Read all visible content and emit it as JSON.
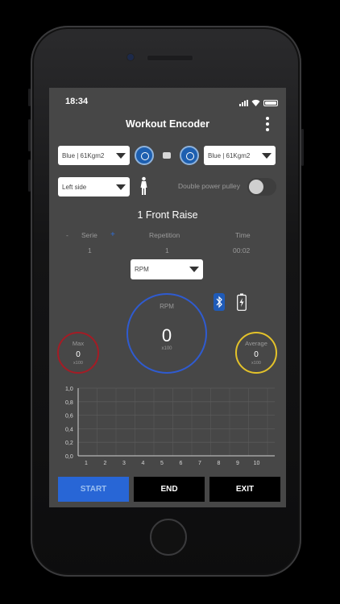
{
  "status": {
    "time": "18:34"
  },
  "header": {
    "title": "Workout Encoder"
  },
  "encoders": {
    "left_select": "Blue | 61Kgm2",
    "right_select": "Blue | 61Kgm2"
  },
  "side": {
    "select": "Left side",
    "double_pulley_label": "Double power pulley",
    "double_pulley_on": false
  },
  "exercise": {
    "title": "1 Front Raise"
  },
  "stats": {
    "serie_label": "Serie",
    "serie_value": "1",
    "serie_minus": "-",
    "serie_plus": "+",
    "repetition_label": "Repetition",
    "repetition_value": "1",
    "time_label": "Time",
    "time_value": "00:02"
  },
  "metric_select": "RPM",
  "gauges": {
    "main": {
      "label": "RPM",
      "value": "0",
      "unit": "x100",
      "color": "#2f5bd0"
    },
    "max": {
      "label": "Max",
      "value": "0",
      "unit": "x100",
      "color": "#a41c25"
    },
    "average": {
      "label": "Average",
      "value": "0",
      "unit": "x100",
      "color": "#e3c22a"
    }
  },
  "chart_data": {
    "type": "bar",
    "categories": [
      "1",
      "2",
      "3",
      "4",
      "5",
      "6",
      "7",
      "8",
      "9",
      "10"
    ],
    "values": [
      0,
      0,
      0,
      0,
      0,
      0,
      0,
      0,
      0,
      0
    ],
    "yticks": [
      "1,0",
      "0,8",
      "0,6",
      "0,4",
      "0,2",
      "0,0"
    ],
    "ylim": [
      0,
      1.0
    ],
    "title": "",
    "xlabel": "",
    "ylabel": "",
    "grid": true
  },
  "actions": {
    "start": "START",
    "end": "END",
    "exit": "EXIT"
  },
  "colors": {
    "accent": "#2866d6",
    "background": "#474747"
  }
}
